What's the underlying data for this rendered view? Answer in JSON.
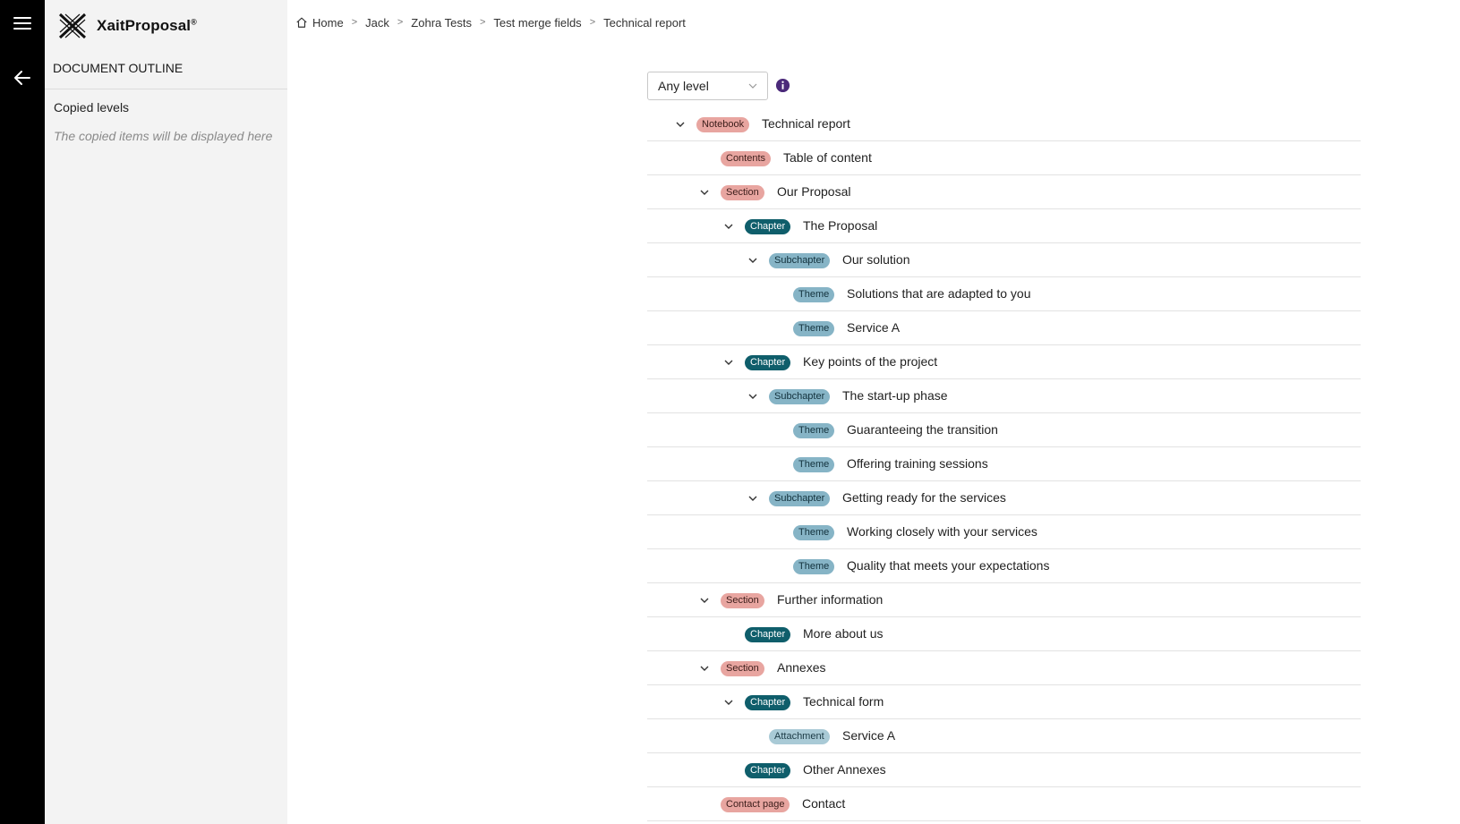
{
  "app": {
    "brand": "XaitProposal",
    "brand_mark": "®"
  },
  "rail": {
    "menu_icon": "hamburger-icon",
    "back_icon": "arrow-left-icon"
  },
  "sidebar": {
    "title": "DOCUMENT OUTLINE",
    "copied_label": "Copied levels",
    "copied_hint": "The copied items will be displayed here"
  },
  "breadcrumb": {
    "home_icon": "home-icon",
    "items": [
      "Home",
      "Jack",
      "Zohra Tests",
      "Test merge fields",
      "Technical report"
    ],
    "separator": ">"
  },
  "filter": {
    "selected": "Any level",
    "info_icon": "info-icon"
  },
  "colors": {
    "notebook": "#e8a5a0",
    "chapter": "#0f5e6b",
    "subchapter": "#86b4c6",
    "theme": "#86b4c6",
    "attachment": "#a9cad6"
  },
  "tree": [
    {
      "depth": 0,
      "expanded": true,
      "badge": "Notebook",
      "badge_style": "salmon",
      "title": "Technical report"
    },
    {
      "depth": 1,
      "expanded": null,
      "badge": "Contents",
      "badge_style": "salmon",
      "title": "Table of content"
    },
    {
      "depth": 1,
      "expanded": true,
      "badge": "Section",
      "badge_style": "salmon",
      "title": "Our Proposal"
    },
    {
      "depth": 2,
      "expanded": true,
      "badge": "Chapter",
      "badge_style": "teal",
      "title": "The Proposal"
    },
    {
      "depth": 3,
      "expanded": true,
      "badge": "Subchapter",
      "badge_style": "blue",
      "title": "Our solution"
    },
    {
      "depth": 4,
      "expanded": null,
      "badge": "Theme",
      "badge_style": "blue",
      "title": "Solutions that are adapted to you"
    },
    {
      "depth": 4,
      "expanded": null,
      "badge": "Theme",
      "badge_style": "blue",
      "title": "Service A"
    },
    {
      "depth": 2,
      "expanded": true,
      "badge": "Chapter",
      "badge_style": "teal",
      "title": "Key points of the project"
    },
    {
      "depth": 3,
      "expanded": true,
      "badge": "Subchapter",
      "badge_style": "blue",
      "title": "The start-up phase"
    },
    {
      "depth": 4,
      "expanded": null,
      "badge": "Theme",
      "badge_style": "blue",
      "title": "Guaranteeing the transition"
    },
    {
      "depth": 4,
      "expanded": null,
      "badge": "Theme",
      "badge_style": "blue",
      "title": "Offering training sessions"
    },
    {
      "depth": 3,
      "expanded": true,
      "badge": "Subchapter",
      "badge_style": "blue",
      "title": "Getting ready for the services"
    },
    {
      "depth": 4,
      "expanded": null,
      "badge": "Theme",
      "badge_style": "blue",
      "title": "Working closely with your services"
    },
    {
      "depth": 4,
      "expanded": null,
      "badge": "Theme",
      "badge_style": "blue",
      "title": "Quality that meets your expectations"
    },
    {
      "depth": 1,
      "expanded": true,
      "badge": "Section",
      "badge_style": "salmon",
      "title": "Further information"
    },
    {
      "depth": 2,
      "expanded": null,
      "badge": "Chapter",
      "badge_style": "teal",
      "title": "More about us"
    },
    {
      "depth": 1,
      "expanded": true,
      "badge": "Section",
      "badge_style": "salmon",
      "title": "Annexes"
    },
    {
      "depth": 2,
      "expanded": true,
      "badge": "Chapter",
      "badge_style": "teal",
      "title": "Technical form"
    },
    {
      "depth": 3,
      "expanded": null,
      "badge": "Attachment",
      "badge_style": "ltblue",
      "title": "Service A"
    },
    {
      "depth": 2,
      "expanded": null,
      "badge": "Chapter",
      "badge_style": "teal",
      "title": "Other Annexes"
    },
    {
      "depth": 1,
      "expanded": null,
      "badge": "Contact page",
      "badge_style": "salmon",
      "title": "Contact"
    }
  ]
}
